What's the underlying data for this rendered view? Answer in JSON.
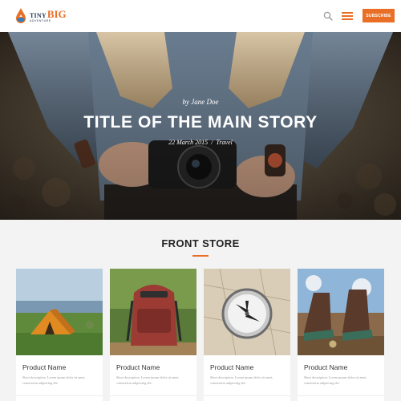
{
  "header": {
    "logo": {
      "tiny": "TINY",
      "big": "BIG",
      "sub": "ADVENTURE"
    },
    "search_icon": "search-icon",
    "menu_icon": "hamburger-menu-icon",
    "subscribe_label": "SUBSCRIBE",
    "accent_color": "#e96f26"
  },
  "hero": {
    "author": "by Jane Doe",
    "title": "TITLE OF THE MAIN STORY",
    "date": "22 March 2015",
    "separator": "/",
    "category": "Travel"
  },
  "store": {
    "title": "FRONT STORE",
    "products": [
      {
        "name": "Product Name",
        "description": "Short description. Lorem ipsum dolor sit amet, consectetur adipiscing elit.",
        "image": "tent-photo"
      },
      {
        "name": "Product Name",
        "description": "Short description. Lorem ipsum dolor sit amet, consectetur adipiscing elit.",
        "image": "backpack-photo"
      },
      {
        "name": "Product Name",
        "description": "Short description. Lorem ipsum dolor sit amet, consectetur adipiscing elit.",
        "image": "compass-photo"
      },
      {
        "name": "Product Name",
        "description": "Short description. Lorem ipsum dolor sit amet, consectetur adipiscing elit.",
        "image": "boots-photo"
      }
    ]
  }
}
